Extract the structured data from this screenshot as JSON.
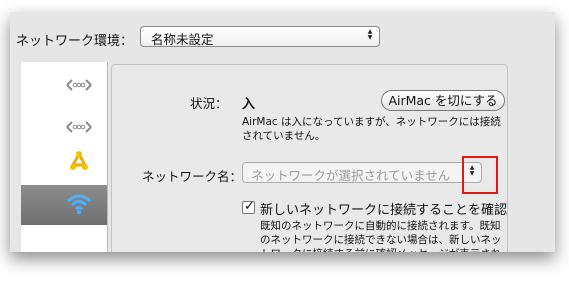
{
  "header": {
    "env_label": "ネットワーク環境：",
    "env_value": "名称未設定"
  },
  "sidebar": {
    "items": [
      {
        "icon": "ethernet-icon",
        "selected": false
      },
      {
        "icon": "ethernet-icon",
        "selected": false
      },
      {
        "icon": "firewire-icon",
        "selected": false
      },
      {
        "icon": "airport-icon",
        "selected": true
      }
    ]
  },
  "main": {
    "status_label": "状況：",
    "status_value": "入",
    "toggle_button": "AirMac を切にする",
    "status_desc": "AirMac は入になっていますが、ネットワークには接続されていません。",
    "network_label": "ネットワーク名：",
    "network_placeholder": "ネットワークが選択されていません",
    "ask_checkbox_label": "新しいネットワークに接続することを確認",
    "ask_checkbox_checked": true,
    "ask_hint": "既知のネットワークに自動的に接続されます。既知のネットワークに接続できない場合は、新しいネットワークに接続する前に確認メッセージが表示されます。"
  },
  "colors": {
    "highlight_box": "#e01818",
    "sidebar_selected": "#7a7a7a"
  }
}
